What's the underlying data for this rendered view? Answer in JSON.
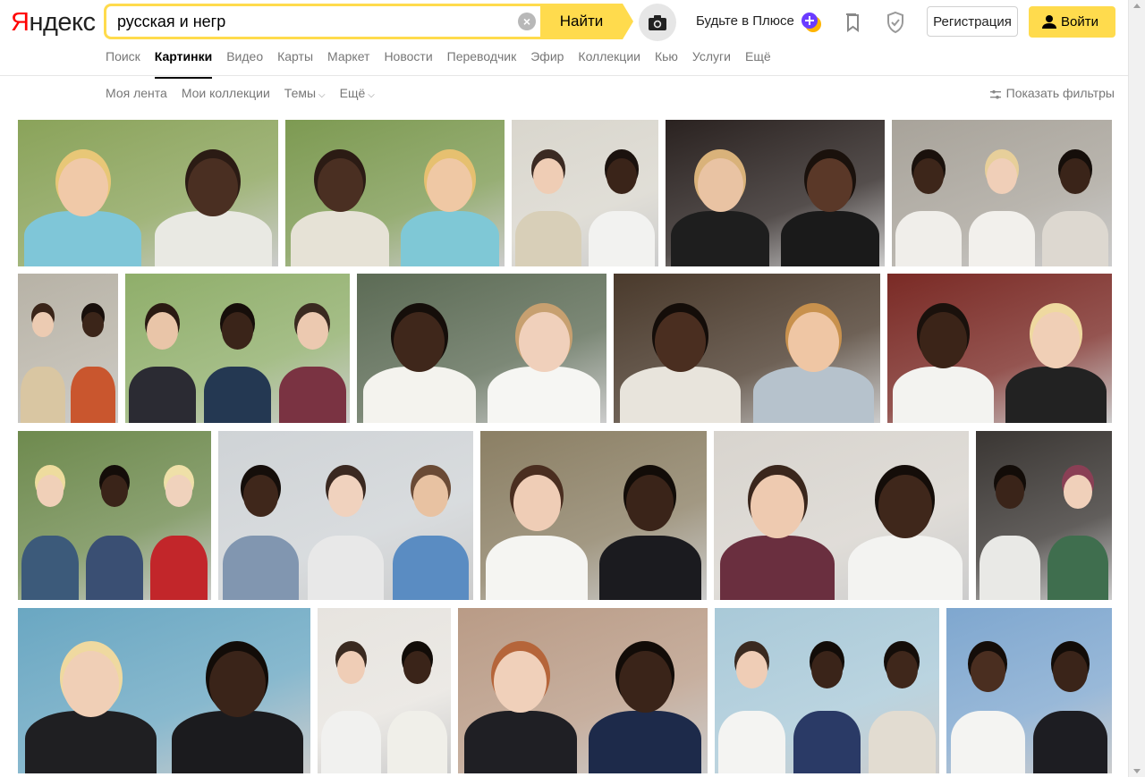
{
  "logo": {
    "first": "Я",
    "rest": "ндекс"
  },
  "search": {
    "value": "русская и негр",
    "clear_label": "×",
    "button_label": "Найти"
  },
  "header": {
    "plus_label": "Будьте в Плюсе",
    "register_label": "Регистрация",
    "login_label": "Войти"
  },
  "nav": {
    "items": [
      {
        "label": "Поиск",
        "active": false
      },
      {
        "label": "Картинки",
        "active": true
      },
      {
        "label": "Видео",
        "active": false
      },
      {
        "label": "Карты",
        "active": false
      },
      {
        "label": "Маркет",
        "active": false
      },
      {
        "label": "Новости",
        "active": false
      },
      {
        "label": "Переводчик",
        "active": false
      },
      {
        "label": "Эфир",
        "active": false
      },
      {
        "label": "Коллекции",
        "active": false
      },
      {
        "label": "Кью",
        "active": false
      },
      {
        "label": "Услуги",
        "active": false
      },
      {
        "label": "Ещё",
        "active": false
      }
    ]
  },
  "subbar": {
    "items": [
      {
        "label": "Моя лента",
        "dropdown": false
      },
      {
        "label": "Мои коллекции",
        "dropdown": false
      },
      {
        "label": "Темы",
        "dropdown": true
      },
      {
        "label": "Ещё",
        "dropdown": true
      }
    ],
    "filters_label": "Показать фильтры"
  },
  "colors": {
    "accent": "#ffdb4d",
    "logo_red": "#ff0000"
  },
  "image_results": [
    {
      "bg": "#8aa35a",
      "figures": [
        {
          "skin": "#f0c9a8",
          "hair": "#e8c777",
          "cloth": "#7fc6d8"
        },
        {
          "skin": "#4a2f22",
          "hair": "#2b1b14",
          "cloth": "#e9e9e3"
        }
      ]
    },
    {
      "bg": "#7d9a52",
      "figures": [
        {
          "skin": "#4a2f22",
          "hair": "#2b1b14",
          "cloth": "#e6e2d6"
        },
        {
          "skin": "#efc8a4",
          "hair": "#e6c070",
          "cloth": "#7fc8d6"
        }
      ]
    },
    {
      "bg": "#d9d6cd",
      "figures": [
        {
          "skin": "#efcdb5",
          "hair": "#3b2a22",
          "cloth": "#d8cfb8"
        },
        {
          "skin": "#3a2419",
          "hair": "#1b120e",
          "cloth": "#f2f2f0"
        }
      ]
    },
    {
      "bg": "#2a2220",
      "figures": [
        {
          "skin": "#e9c3a3",
          "hair": "#d9b27a",
          "cloth": "#1e1e1e"
        },
        {
          "skin": "#5a3828",
          "hair": "#1a110c",
          "cloth": "#1a1a1a"
        }
      ]
    },
    {
      "bg": "#a8a39a",
      "figures": [
        {
          "skin": "#3d261a",
          "hair": "#1a110c",
          "cloth": "#f0eeea"
        },
        {
          "skin": "#f0cfb8",
          "hair": "#e7cf9a",
          "cloth": "#f2f0ec"
        },
        {
          "skin": "#3a2419",
          "hair": "#150e0a",
          "cloth": "#ddd8d0"
        }
      ]
    },
    {
      "bg": "#b7b2a6",
      "figures": [
        {
          "skin": "#eccbb2",
          "hair": "#3a2519",
          "cloth": "#d9c6a2"
        },
        {
          "skin": "#3b2519",
          "hair": "#180f0b",
          "cloth": "#c9562e"
        }
      ]
    },
    {
      "bg": "#8fae6a",
      "figures": [
        {
          "skin": "#e9c5a8",
          "hair": "#2a1a12",
          "cloth": "#2b2b33"
        },
        {
          "skin": "#3a2419",
          "hair": "#160e0a",
          "cloth": "#243852"
        },
        {
          "skin": "#ecc9b0",
          "hair": "#3a2a20",
          "cloth": "#7a3342"
        }
      ]
    },
    {
      "bg": "#5c6b55",
      "figures": [
        {
          "skin": "#3f271b",
          "hair": "#150e0a",
          "cloth": "#f4f3ee"
        },
        {
          "skin": "#f0d0bb",
          "hair": "#c7a070",
          "cloth": "#f6f6f3"
        }
      ]
    },
    {
      "bg": "#4a3a2c",
      "figures": [
        {
          "skin": "#4a2e20",
          "hair": "#140d09",
          "cloth": "#e8e4dc"
        },
        {
          "skin": "#efc6a4",
          "hair": "#c8914d",
          "cloth": "#b6c2cc"
        }
      ]
    },
    {
      "bg": "#7a2a25",
      "figures": [
        {
          "skin": "#3b2418",
          "hair": "#1a110c",
          "cloth": "#f3f3f0"
        },
        {
          "skin": "#f0cfb6",
          "hair": "#efd9a0",
          "cloth": "#222222"
        }
      ]
    },
    {
      "bg": "#6e8a4e",
      "figures": [
        {
          "skin": "#f0d0b8",
          "hair": "#eedc9e",
          "cloth": "#3c5a7a"
        },
        {
          "skin": "#3a2419",
          "hair": "#140d09",
          "cloth": "#3a4f73"
        },
        {
          "skin": "#f0d2bc",
          "hair": "#efe0a8",
          "cloth": "#c2262a"
        }
      ]
    },
    {
      "bg": "#cfd3d6",
      "figures": [
        {
          "skin": "#3f271b",
          "hair": "#150e0a",
          "cloth": "#8196b0"
        },
        {
          "skin": "#f0d2be",
          "hair": "#3a2820",
          "cloth": "#e8e8e8"
        },
        {
          "skin": "#e8c2a2",
          "hair": "#6a4a35",
          "cloth": "#5a8cc2"
        }
      ]
    },
    {
      "bg": "#8b7f64",
      "figures": [
        {
          "skin": "#efcdb6",
          "hair": "#4a2e20",
          "cloth": "#f5f5f2"
        },
        {
          "skin": "#3a2419",
          "hair": "#120c08",
          "cloth": "#1b1b1f"
        }
      ]
    },
    {
      "bg": "#d8d4ce",
      "figures": [
        {
          "skin": "#eecab0",
          "hair": "#3a261c",
          "cloth": "#6a2f3f"
        },
        {
          "skin": "#3f271b",
          "hair": "#140d09",
          "cloth": "#f3f3f1"
        }
      ]
    },
    {
      "bg": "#3a3633",
      "figures": [
        {
          "skin": "#3a2419",
          "hair": "#120c08",
          "cloth": "#e9e9e6"
        },
        {
          "skin": "#f0d0ba",
          "hair": "#8a3f55",
          "cloth": "#3f6e4e"
        }
      ]
    },
    {
      "bg": "#6aa7c2",
      "figures": [
        {
          "skin": "#f0cfb6",
          "hair": "#efd9a0",
          "cloth": "#1f1f22"
        },
        {
          "skin": "#3a2419",
          "hair": "#120c08",
          "cloth": "#1b1b1e"
        }
      ]
    },
    {
      "bg": "#e7e4df",
      "figures": [
        {
          "skin": "#efcdb6",
          "hair": "#3a2a20",
          "cloth": "#f1f1ef"
        },
        {
          "skin": "#3a2419",
          "hair": "#120c08",
          "cloth": "#f0efe9"
        }
      ]
    },
    {
      "bg": "#b99b86",
      "figures": [
        {
          "skin": "#f0d0ba",
          "hair": "#b5653a",
          "cloth": "#1f1f24"
        },
        {
          "skin": "#3a2419",
          "hair": "#120c08",
          "cloth": "#1d2a4a"
        }
      ]
    },
    {
      "bg": "#a9c9d8",
      "figures": [
        {
          "skin": "#efcdb6",
          "hair": "#3a2a20",
          "cloth": "#f4f4f2"
        },
        {
          "skin": "#3a2419",
          "hair": "#120c08",
          "cloth": "#2a3a66"
        },
        {
          "skin": "#3f271b",
          "hair": "#140d09",
          "cloth": "#e2dcd1"
        }
      ]
    },
    {
      "bg": "#7fa7cf",
      "figures": [
        {
          "skin": "#4a2e20",
          "hair": "#140d09",
          "cloth": "#f4f4f2"
        },
        {
          "skin": "#3a2419",
          "hair": "#120c08",
          "cloth": "#1d1d22"
        }
      ]
    }
  ]
}
